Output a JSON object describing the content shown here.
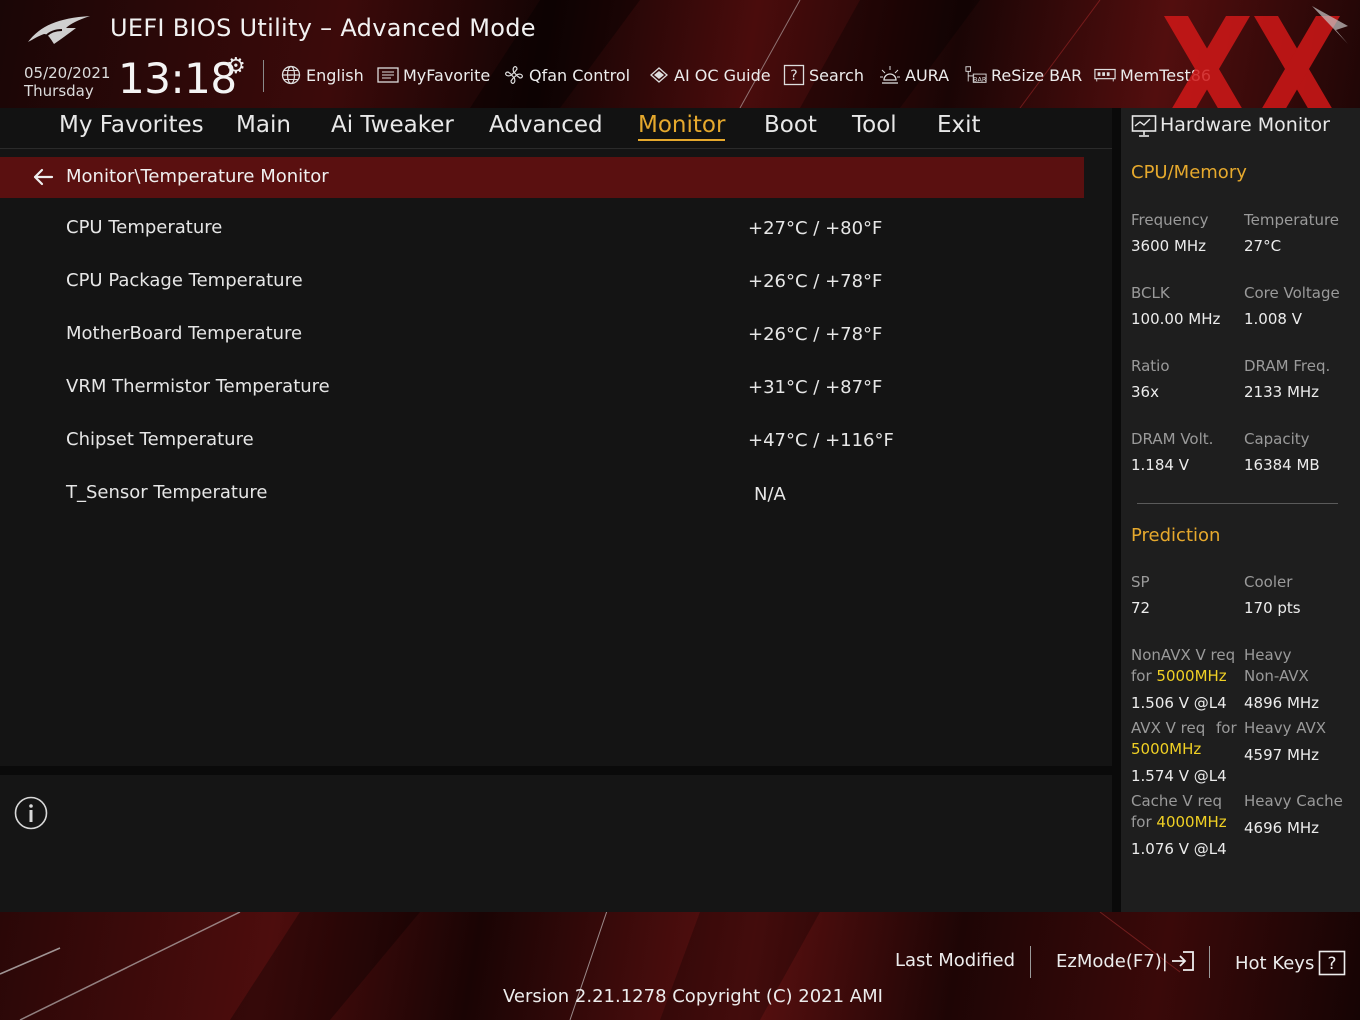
{
  "header": {
    "title": "UEFI BIOS Utility – Advanced Mode",
    "date": "05/20/2021",
    "weekday": "Thursday",
    "time": "13:18",
    "tools": [
      {
        "label": "English",
        "icon": "globe-icon"
      },
      {
        "label": "MyFavorite",
        "icon": "favorite-list-icon"
      },
      {
        "label": "Qfan Control",
        "icon": "fan-icon"
      },
      {
        "label": "AI OC Guide",
        "icon": "ai-chip-icon"
      },
      {
        "label": "Search",
        "icon": "question-box-icon"
      },
      {
        "label": "AURA",
        "icon": "aura-light-icon"
      },
      {
        "label": "ReSize BAR",
        "icon": "resize-bar-icon"
      },
      {
        "label": "MemTest86",
        "icon": "memory-icon"
      }
    ]
  },
  "menu": {
    "items": [
      "My Favorites",
      "Main",
      "Ai Tweaker",
      "Advanced",
      "Monitor",
      "Boot",
      "Tool",
      "Exit"
    ],
    "active": "Monitor"
  },
  "breadcrumb": "Monitor\\Temperature Monitor",
  "rows": [
    {
      "label": "CPU Temperature",
      "value": "+27°C / +80°F"
    },
    {
      "label": "CPU Package Temperature",
      "value": "+26°C / +78°F"
    },
    {
      "label": "MotherBoard Temperature",
      "value": "+26°C / +78°F"
    },
    {
      "label": "VRM Thermistor Temperature",
      "value": "+31°C / +87°F"
    },
    {
      "label": "Chipset Temperature",
      "value": "+47°C / +116°F"
    },
    {
      "label": "T_Sensor Temperature",
      "value": "N/A"
    }
  ],
  "hardware_monitor": {
    "title": "Hardware Monitor",
    "cpu_memory": {
      "title": "CPU/Memory",
      "frequency_label": "Frequency",
      "frequency_value": "3600 MHz",
      "temperature_label": "Temperature",
      "temperature_value": "27°C",
      "bclk_label": "BCLK",
      "bclk_value": "100.00 MHz",
      "core_voltage_label": "Core Voltage",
      "core_voltage_value": "1.008 V",
      "ratio_label": "Ratio",
      "ratio_value": "36x",
      "dram_freq_label": "DRAM Freq.",
      "dram_freq_value": "2133 MHz",
      "dram_volt_label": "DRAM Volt.",
      "dram_volt_value": "1.184 V",
      "capacity_label": "Capacity",
      "capacity_value": "16384 MB"
    },
    "prediction": {
      "title": "Prediction",
      "sp_label": "SP",
      "sp_value": "72",
      "cooler_label": "Cooler",
      "cooler_value": "170 pts",
      "nonavx_label_1": "NonAVX V req",
      "nonavx_label_2": "for",
      "nonavx_freq": "5000MHz",
      "nonavx_value": "1.506 V @L4",
      "heavy_nonavx_label_1": "Heavy",
      "heavy_nonavx_label_2": "Non-AVX",
      "heavy_nonavx_value": "4896 MHz",
      "avx_label_1": "AVX V req",
      "avx_label_for": "for",
      "avx_freq": "5000MHz",
      "avx_value": "1.574 V @L4",
      "heavy_avx_label": "Heavy AVX",
      "heavy_avx_value": "4597 MHz",
      "cache_label_1": "Cache V req",
      "cache_label_2": "for",
      "cache_freq": "4000MHz",
      "cache_value": "1.076 V @L4",
      "heavy_cache_label": "Heavy Cache",
      "heavy_cache_value": "4696 MHz"
    }
  },
  "footer": {
    "last_modified": "Last Modified",
    "ezmode": "EzMode(F7)|",
    "hotkeys": "Hot Keys",
    "version": "Version 2.21.1278 Copyright (C) 2021 AMI"
  },
  "colors": {
    "accent": "#e6a92d",
    "highlight": "#f0d024",
    "breadcrumb_bg": "#5a1010",
    "panel_bg": "#1e1e1e"
  }
}
